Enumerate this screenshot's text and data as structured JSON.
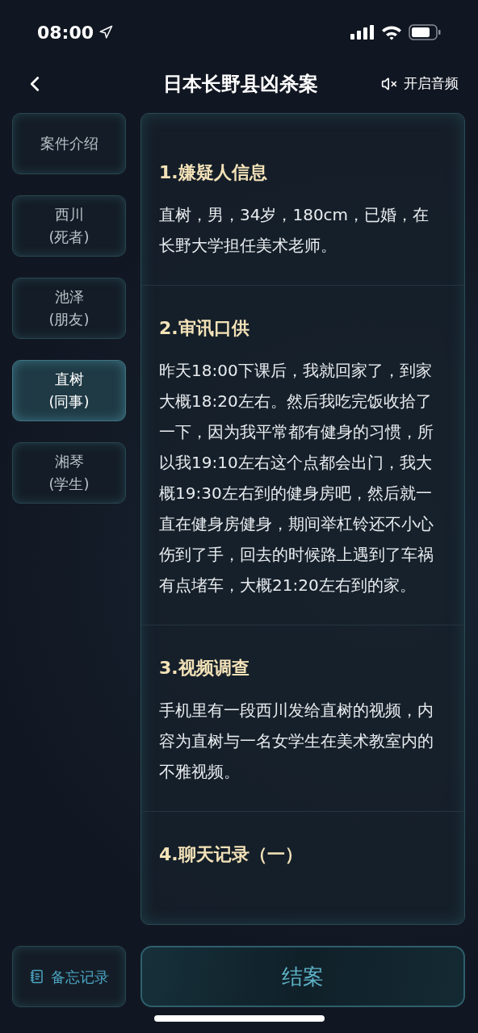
{
  "status_bar": {
    "time": "08:00"
  },
  "header": {
    "title": "日本长野县凶杀案",
    "audio": {
      "label": "开启音频",
      "muted": true
    }
  },
  "sidebar": {
    "items": [
      {
        "lines": [
          "案件介绍"
        ],
        "selected": false
      },
      {
        "lines": [
          "西川",
          "(死者)"
        ],
        "selected": false
      },
      {
        "lines": [
          "池泽",
          "(朋友)"
        ],
        "selected": false
      },
      {
        "lines": [
          "直树",
          "(同事)"
        ],
        "selected": true
      },
      {
        "lines": [
          "湘琴",
          "(学生)"
        ],
        "selected": false
      }
    ]
  },
  "sections": [
    {
      "title": "1.嫌疑人信息",
      "body": "直树，男，34岁，180cm，已婚，在长野大学担任美术老师。"
    },
    {
      "title": "2.审讯口供",
      "body": "昨天18:00下课后，我就回家了，到家大概18:20左右。然后我吃完饭收拾了一下，因为我平常都有健身的习惯，所以我19:10左右这个点都会出门，我大概19:30左右到的健身房吧，然后就一直在健身房健身，期间举杠铃还不小心伤到了手，回去的时候路上遇到了车祸有点堵车，大概21:20左右到的家。"
    },
    {
      "title": "3.视频调查",
      "body": "手机里有一段西川发给直树的视频，内容为直树与一名女学生在美术教室内的不雅视频。"
    },
    {
      "title": "4.聊天记录（一）"
    }
  ],
  "footer": {
    "memo_button": "备忘记录",
    "close_button": "结案"
  }
}
